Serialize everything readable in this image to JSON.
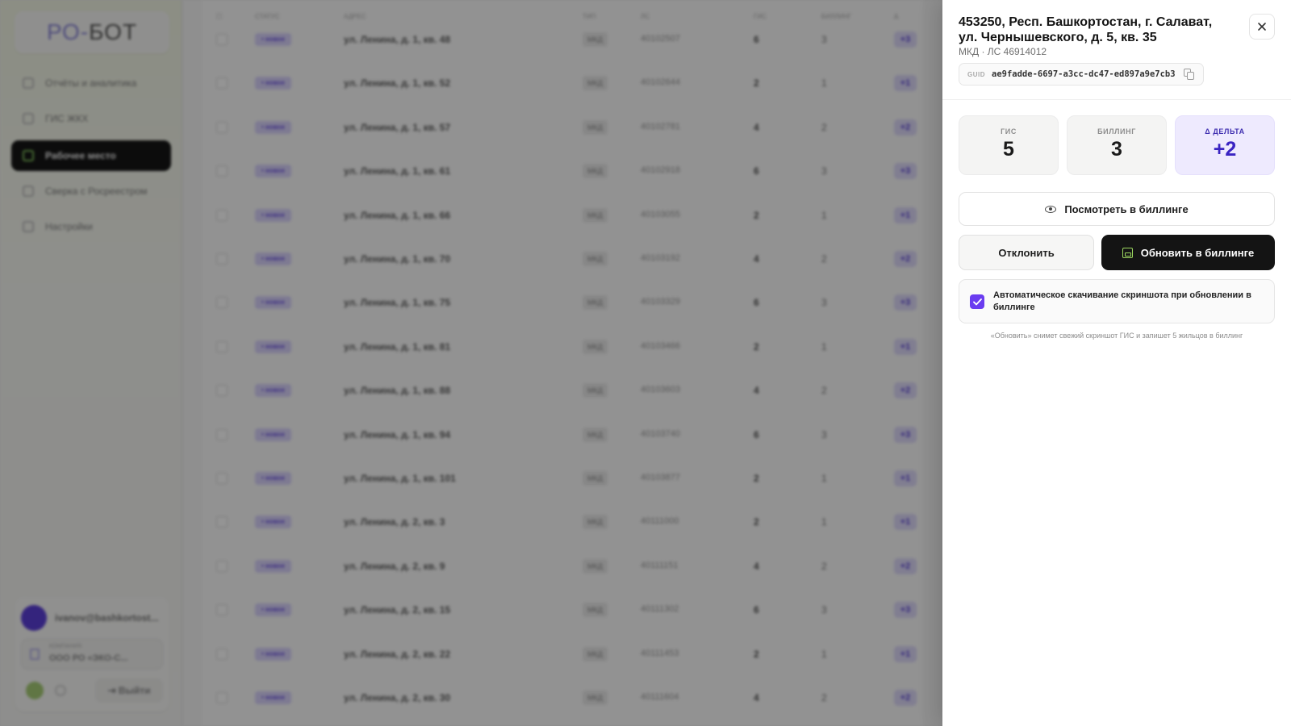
{
  "app": {
    "logo_part1": "РО-",
    "logo_part2": "БОТ",
    "nav": [
      {
        "label": "Отчёты и аналитика"
      },
      {
        "label": "ГИС ЖКХ"
      },
      {
        "label": "Рабочее место",
        "active": true
      },
      {
        "label": "Сверка с Росреестром"
      },
      {
        "label": "Настройки"
      }
    ],
    "user_email": "ivanov@bashkortost...",
    "org_caption": "КОМПАНИЯ",
    "org_name": "ООО РО «ЭКО-С...",
    "logout_label": "Выйти"
  },
  "table": {
    "headers": [
      "Статус",
      "Адрес",
      "Тип",
      "ЛС",
      "ГИС",
      "Биллинг",
      "Δ"
    ],
    "rows": [
      {
        "status": "• новое",
        "address": "ул. Ленина, д. 1, кв. 48",
        "type": "МКД",
        "ls": "40102507",
        "gis": "6",
        "billing": "3",
        "delta": "+3"
      },
      {
        "status": "• новое",
        "address": "ул. Ленина, д. 1, кв. 52",
        "type": "МКД",
        "ls": "40102644",
        "gis": "2",
        "billing": "1",
        "delta": "+1"
      },
      {
        "status": "• новое",
        "address": "ул. Ленина, д. 1, кв. 57",
        "type": "МКД",
        "ls": "40102781",
        "gis": "4",
        "billing": "2",
        "delta": "+2"
      },
      {
        "status": "• новое",
        "address": "ул. Ленина, д. 1, кв. 61",
        "type": "МКД",
        "ls": "40102918",
        "gis": "6",
        "billing": "3",
        "delta": "+3"
      },
      {
        "status": "• новое",
        "address": "ул. Ленина, д. 1, кв. 66",
        "type": "МКД",
        "ls": "40103055",
        "gis": "2",
        "billing": "1",
        "delta": "+1"
      },
      {
        "status": "• новое",
        "address": "ул. Ленина, д. 1, кв. 70",
        "type": "МКД",
        "ls": "40103192",
        "gis": "4",
        "billing": "2",
        "delta": "+2"
      },
      {
        "status": "• новое",
        "address": "ул. Ленина, д. 1, кв. 75",
        "type": "МКД",
        "ls": "40103329",
        "gis": "6",
        "billing": "3",
        "delta": "+3"
      },
      {
        "status": "• новое",
        "address": "ул. Ленина, д. 1, кв. 81",
        "type": "МКД",
        "ls": "40103466",
        "gis": "2",
        "billing": "1",
        "delta": "+1"
      },
      {
        "status": "• новое",
        "address": "ул. Ленина, д. 1, кв. 88",
        "type": "МКД",
        "ls": "40103603",
        "gis": "4",
        "billing": "2",
        "delta": "+2"
      },
      {
        "status": "• новое",
        "address": "ул. Ленина, д. 1, кв. 94",
        "type": "МКД",
        "ls": "40103740",
        "gis": "6",
        "billing": "3",
        "delta": "+3"
      },
      {
        "status": "• новое",
        "address": "ул. Ленина, д. 1, кв. 101",
        "type": "МКД",
        "ls": "40103877",
        "gis": "2",
        "billing": "1",
        "delta": "+1"
      },
      {
        "status": "• новое",
        "address": "ул. Ленина, д. 2, кв. 3",
        "type": "МКД",
        "ls": "40111000",
        "gis": "2",
        "billing": "1",
        "delta": "+1"
      },
      {
        "status": "• новое",
        "address": "ул. Ленина, д. 2, кв. 9",
        "type": "МКД",
        "ls": "40111151",
        "gis": "4",
        "billing": "2",
        "delta": "+2"
      },
      {
        "status": "• новое",
        "address": "ул. Ленина, д. 2, кв. 15",
        "type": "МКД",
        "ls": "40111302",
        "gis": "6",
        "billing": "3",
        "delta": "+3"
      },
      {
        "status": "• новое",
        "address": "ул. Ленина, д. 2, кв. 22",
        "type": "МКД",
        "ls": "40111453",
        "gis": "2",
        "billing": "1",
        "delta": "+1"
      },
      {
        "status": "• новое",
        "address": "ул. Ленина, д. 2, кв. 30",
        "type": "МКД",
        "ls": "40111604",
        "gis": "4",
        "billing": "2",
        "delta": "+2"
      }
    ]
  },
  "drawer": {
    "title": "453250, Респ. Башкортостан, г. Салават, ул. Чернышевского, д. 5, кв. 35",
    "subtitle": "МКД · ЛС 46914012",
    "guid_label": "GUID",
    "guid_value": "ae9fadde-6697-a3cc-dc47-ed897a9e7cb3",
    "stats": {
      "gis_label": "ГИС",
      "gis_value": "5",
      "billing_label": "БИЛЛИНГ",
      "billing_value": "3",
      "delta_label": "Δ ДЕЛЬТА",
      "delta_value": "+2"
    },
    "view_label": "Посмотреть в биллинге",
    "reject_label": "Отклонить",
    "update_label": "Обновить в биллинге",
    "auto_screenshot_checked": true,
    "auto_screenshot_label": "Автоматическое скачивание скриншота при обновлении в биллинге",
    "hint": "«Обновить» снимет свежий скриншот ГИС и запишет 5 жильцов в биллинг"
  },
  "colors": {
    "accent": "#6a3cf0",
    "primary_button": "#141414",
    "delta_card": "#eeeafe"
  }
}
